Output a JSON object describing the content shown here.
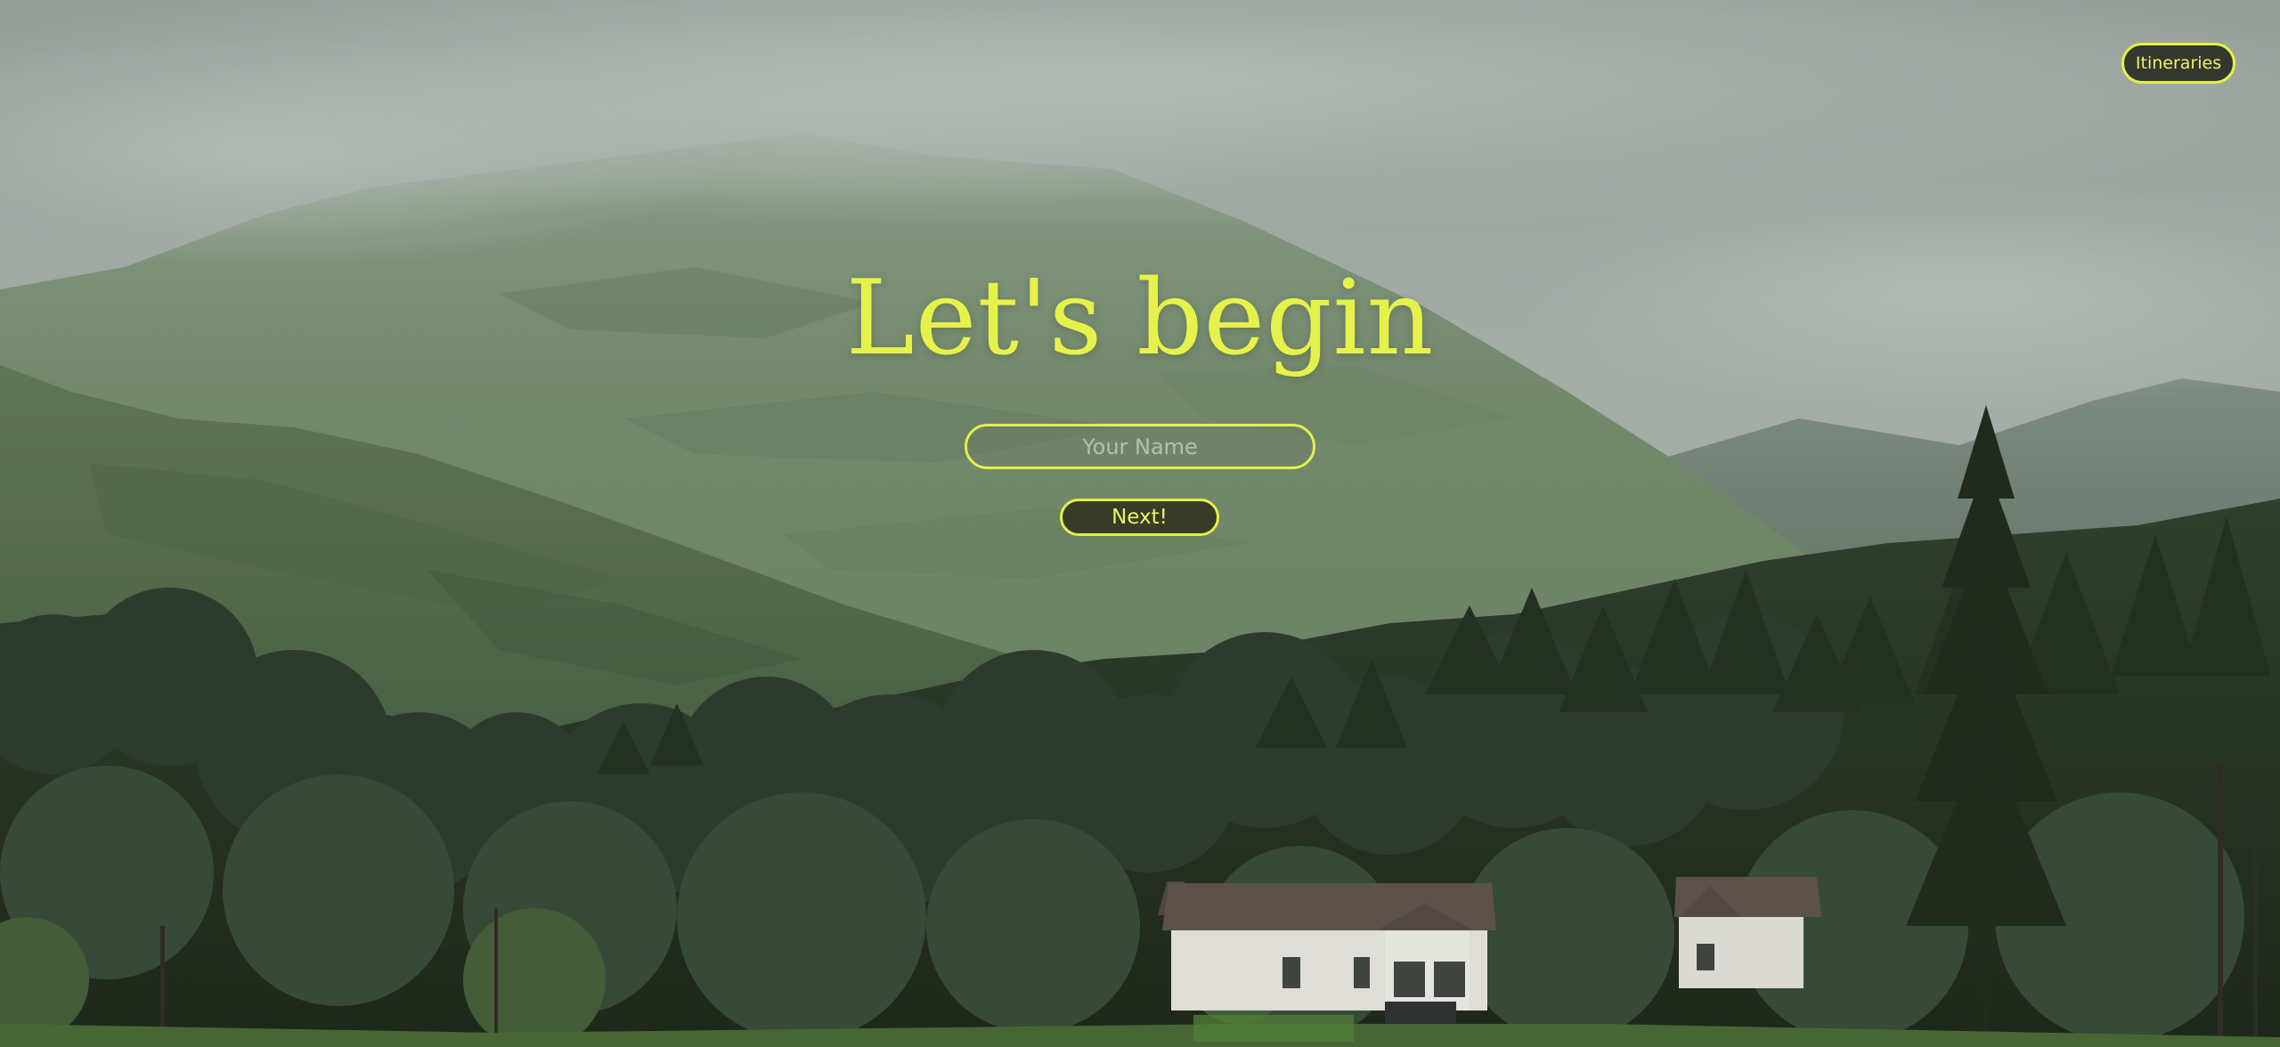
{
  "header": {
    "itineraries_label": "Itineraries"
  },
  "hero": {
    "title": "Let's begin",
    "name_input": {
      "value": "",
      "placeholder": "Your Name"
    },
    "next_label": "Next!"
  },
  "colors": {
    "accent": "#e4f046",
    "button_fill": "#2c2e26",
    "sky": "#a9b0ac",
    "mountain": "#6f8468",
    "forest": "#1f2b1c"
  }
}
